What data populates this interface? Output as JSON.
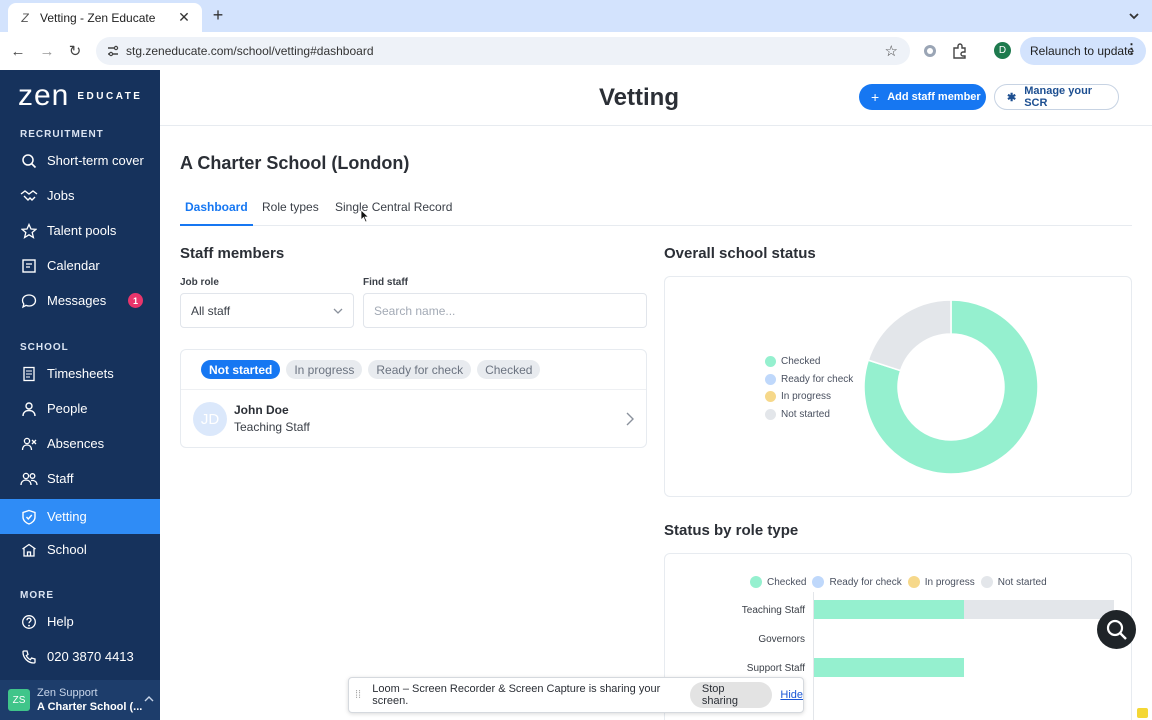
{
  "browser": {
    "tab_title": "Vetting - Zen Educate",
    "tab_favicon": "zen-z-icon",
    "url": "stg.zeneducate.com/school/vetting#dashboard",
    "profile_initial": "D",
    "relaunch_label": "Relaunch to update"
  },
  "brand": {
    "main": "zen",
    "sub": "EDUCATE"
  },
  "sidebar": {
    "sections": [
      {
        "title": "RECRUITMENT"
      },
      {
        "title": "SCHOOL"
      },
      {
        "title": "MORE"
      }
    ],
    "items": [
      {
        "label": "Short-term cover",
        "icon": "search-icon"
      },
      {
        "label": "Jobs",
        "icon": "handshake-icon"
      },
      {
        "label": "Talent pools",
        "icon": "star-icon"
      },
      {
        "label": "Calendar",
        "icon": "calendar-icon"
      },
      {
        "label": "Messages",
        "icon": "chat-icon",
        "badge": "1"
      },
      {
        "label": "Timesheets",
        "icon": "timesheet-icon"
      },
      {
        "label": "People",
        "icon": "person-icon"
      },
      {
        "label": "Absences",
        "icon": "absences-icon"
      },
      {
        "label": "Staff",
        "icon": "staff-icon"
      },
      {
        "label": "Vetting",
        "icon": "shield-check-icon",
        "active": true
      },
      {
        "label": "School",
        "icon": "school-icon"
      },
      {
        "label": "Help",
        "icon": "help-icon"
      },
      {
        "label": "020 3870 4413",
        "icon": "phone-icon"
      }
    ],
    "user": {
      "initials": "ZS",
      "line1": "Zen Support",
      "line2": "A Charter School (..."
    }
  },
  "header": {
    "title": "Vetting",
    "add_staff_label": "Add staff member",
    "manage_scr_label": "Manage your SCR"
  },
  "school_name": "A Charter School (London)",
  "tabs": [
    {
      "label": "Dashboard",
      "active": true
    },
    {
      "label": "Role types"
    },
    {
      "label": "Single Central Record"
    }
  ],
  "staff_members": {
    "title": "Staff members",
    "job_role_label": "Job role",
    "job_role_value": "All staff",
    "find_staff_label": "Find staff",
    "search_placeholder": "Search name...",
    "filters": [
      {
        "label": "Not started",
        "active": true
      },
      {
        "label": "In progress"
      },
      {
        "label": "Ready for check"
      },
      {
        "label": "Checked"
      }
    ],
    "rows": [
      {
        "initials": "JD",
        "name": "John Doe",
        "role": "Teaching Staff"
      }
    ]
  },
  "overall_status": {
    "title": "Overall school status"
  },
  "role_status": {
    "title": "Status by role type"
  },
  "colors": {
    "checked": "#95f0cf",
    "ready_for_check": "#bfd8fb",
    "in_progress": "#f6d88a",
    "not_started": "#e3e6ea",
    "primary": "#1677f2",
    "sidebar": "#16325c"
  },
  "chart_data": [
    {
      "type": "pie",
      "legend_position": "left",
      "labels": [
        "Checked",
        "Ready for check",
        "In progress",
        "Not started"
      ],
      "values": [
        80,
        0,
        0,
        20
      ],
      "donut": true
    },
    {
      "type": "bar",
      "orientation": "horizontal",
      "stacked": true,
      "legend_position": "top",
      "categories": [
        "Teaching Staff",
        "Governors",
        "Support Staff"
      ],
      "series": [
        {
          "name": "Checked",
          "values": [
            1,
            0,
            1
          ]
        },
        {
          "name": "Ready for check",
          "values": [
            0,
            0,
            0
          ]
        },
        {
          "name": "In progress",
          "values": [
            0,
            0,
            0
          ]
        },
        {
          "name": "Not started",
          "values": [
            1,
            0,
            0
          ]
        }
      ],
      "xlim": [
        0,
        2
      ]
    }
  ],
  "overlays": {
    "loom_message": "Loom – Screen Recorder & Screen Capture is sharing your screen.",
    "stop_sharing": "Stop sharing",
    "hide": "Hide"
  }
}
